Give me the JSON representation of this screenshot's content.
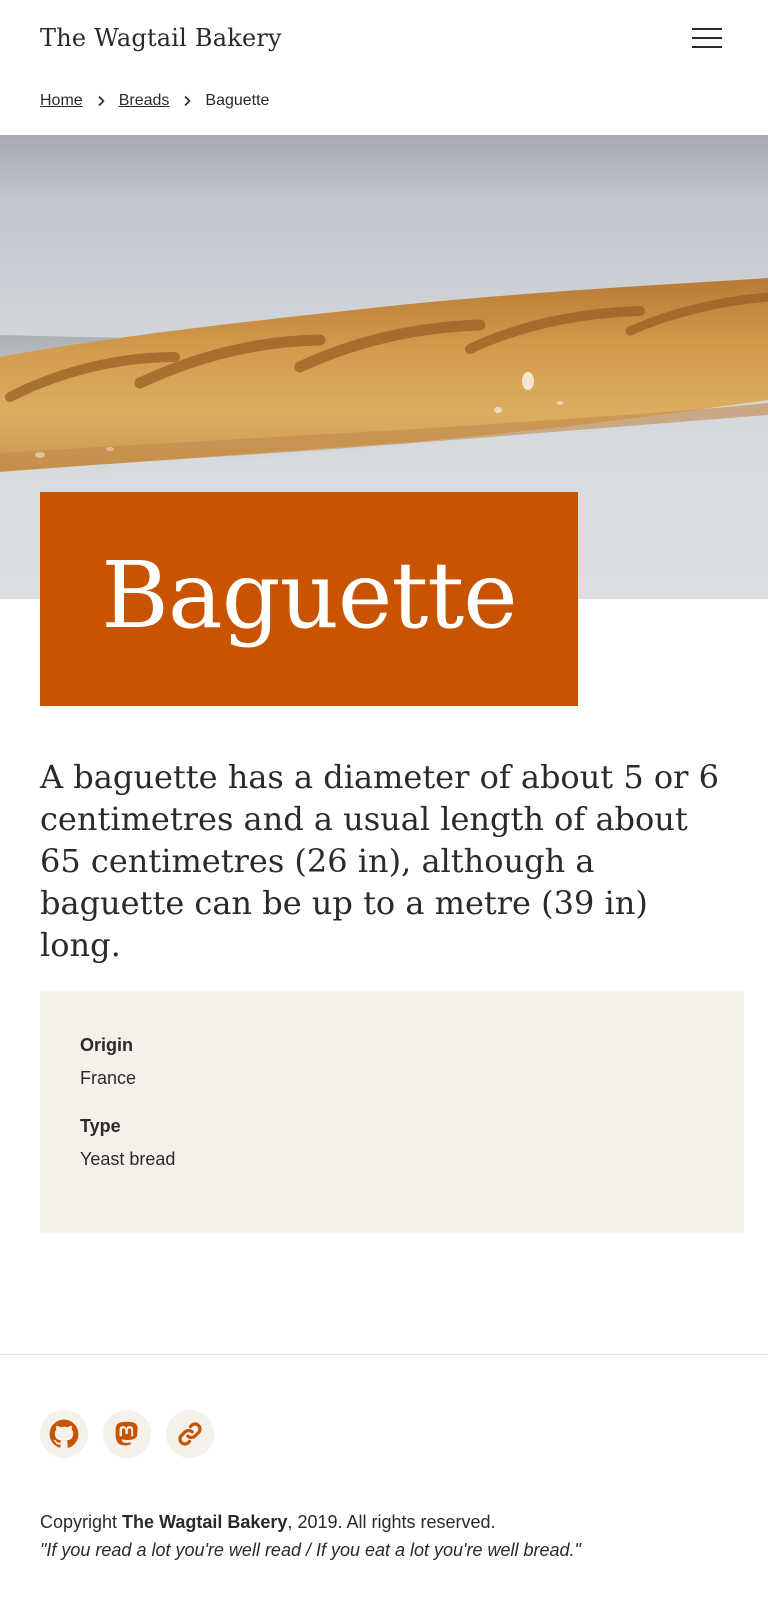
{
  "header": {
    "site_title": "The Wagtail Bakery",
    "menu_label": "Menu"
  },
  "breadcrumb": {
    "items": [
      "Home",
      "Breads"
    ],
    "current": "Baguette"
  },
  "hero": {
    "image": "baguette-photo"
  },
  "page": {
    "title": "Baguette",
    "intro": "A baguette has a diameter of about 5 or 6 centimetres and a usual length of about 65 centimetres (26 in), although a baguette can be up to a metre (39 in) long."
  },
  "facts": [
    {
      "label": "Origin",
      "value": "France"
    },
    {
      "label": "Type",
      "value": "Yeast bread"
    }
  ],
  "footer": {
    "social": [
      {
        "name": "github-icon"
      },
      {
        "name": "mastodon-icon"
      },
      {
        "name": "link-icon"
      }
    ],
    "copyright_prefix": "Copyright ",
    "copyright_brand": "The Wagtail Bakery",
    "copyright_suffix": ", 2019. All rights reserved.",
    "quote": "\"If you read a lot you're well read / If you eat a lot you're well bread.\""
  },
  "colors": {
    "accent": "#c85300",
    "panel": "#f3f1ea",
    "text": "#2a2a2a"
  }
}
